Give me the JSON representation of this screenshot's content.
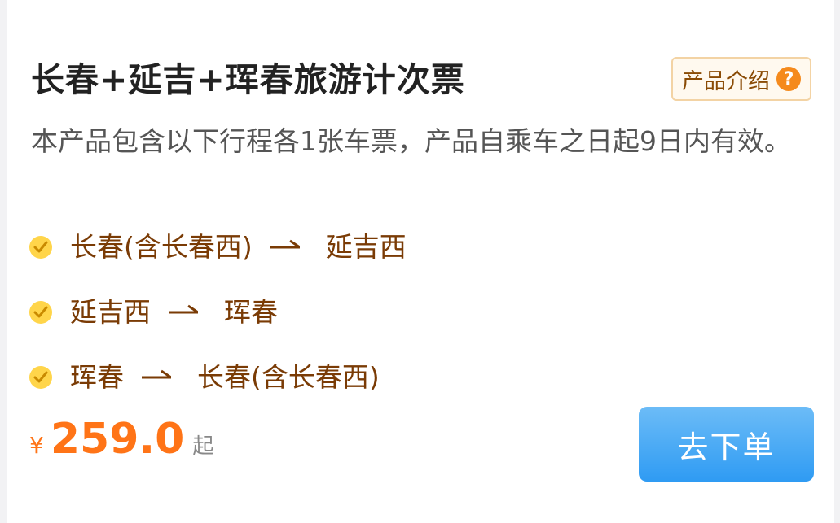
{
  "product": {
    "title": "长春+延吉+珲春旅游计次票",
    "intro_label": "产品介绍",
    "intro_icon": "question-icon",
    "description": "本产品包含以下行程各1张车票，产品自乘车之日起9日内有效。"
  },
  "routes": [
    {
      "from": "长春(含长春西)",
      "to": "延吉西"
    },
    {
      "from": "延吉西",
      "to": "珲春"
    },
    {
      "from": "珲春",
      "to": "长春(含长春西)"
    }
  ],
  "price": {
    "currency": "¥",
    "amount": "259.0",
    "suffix": "起"
  },
  "order_button": {
    "label": "去下单"
  },
  "colors": {
    "accent_orange": "#ff7417",
    "route_text": "#7a3b05",
    "button_blue": "#2f9bf3",
    "check_yellow": "#ffd54a"
  }
}
